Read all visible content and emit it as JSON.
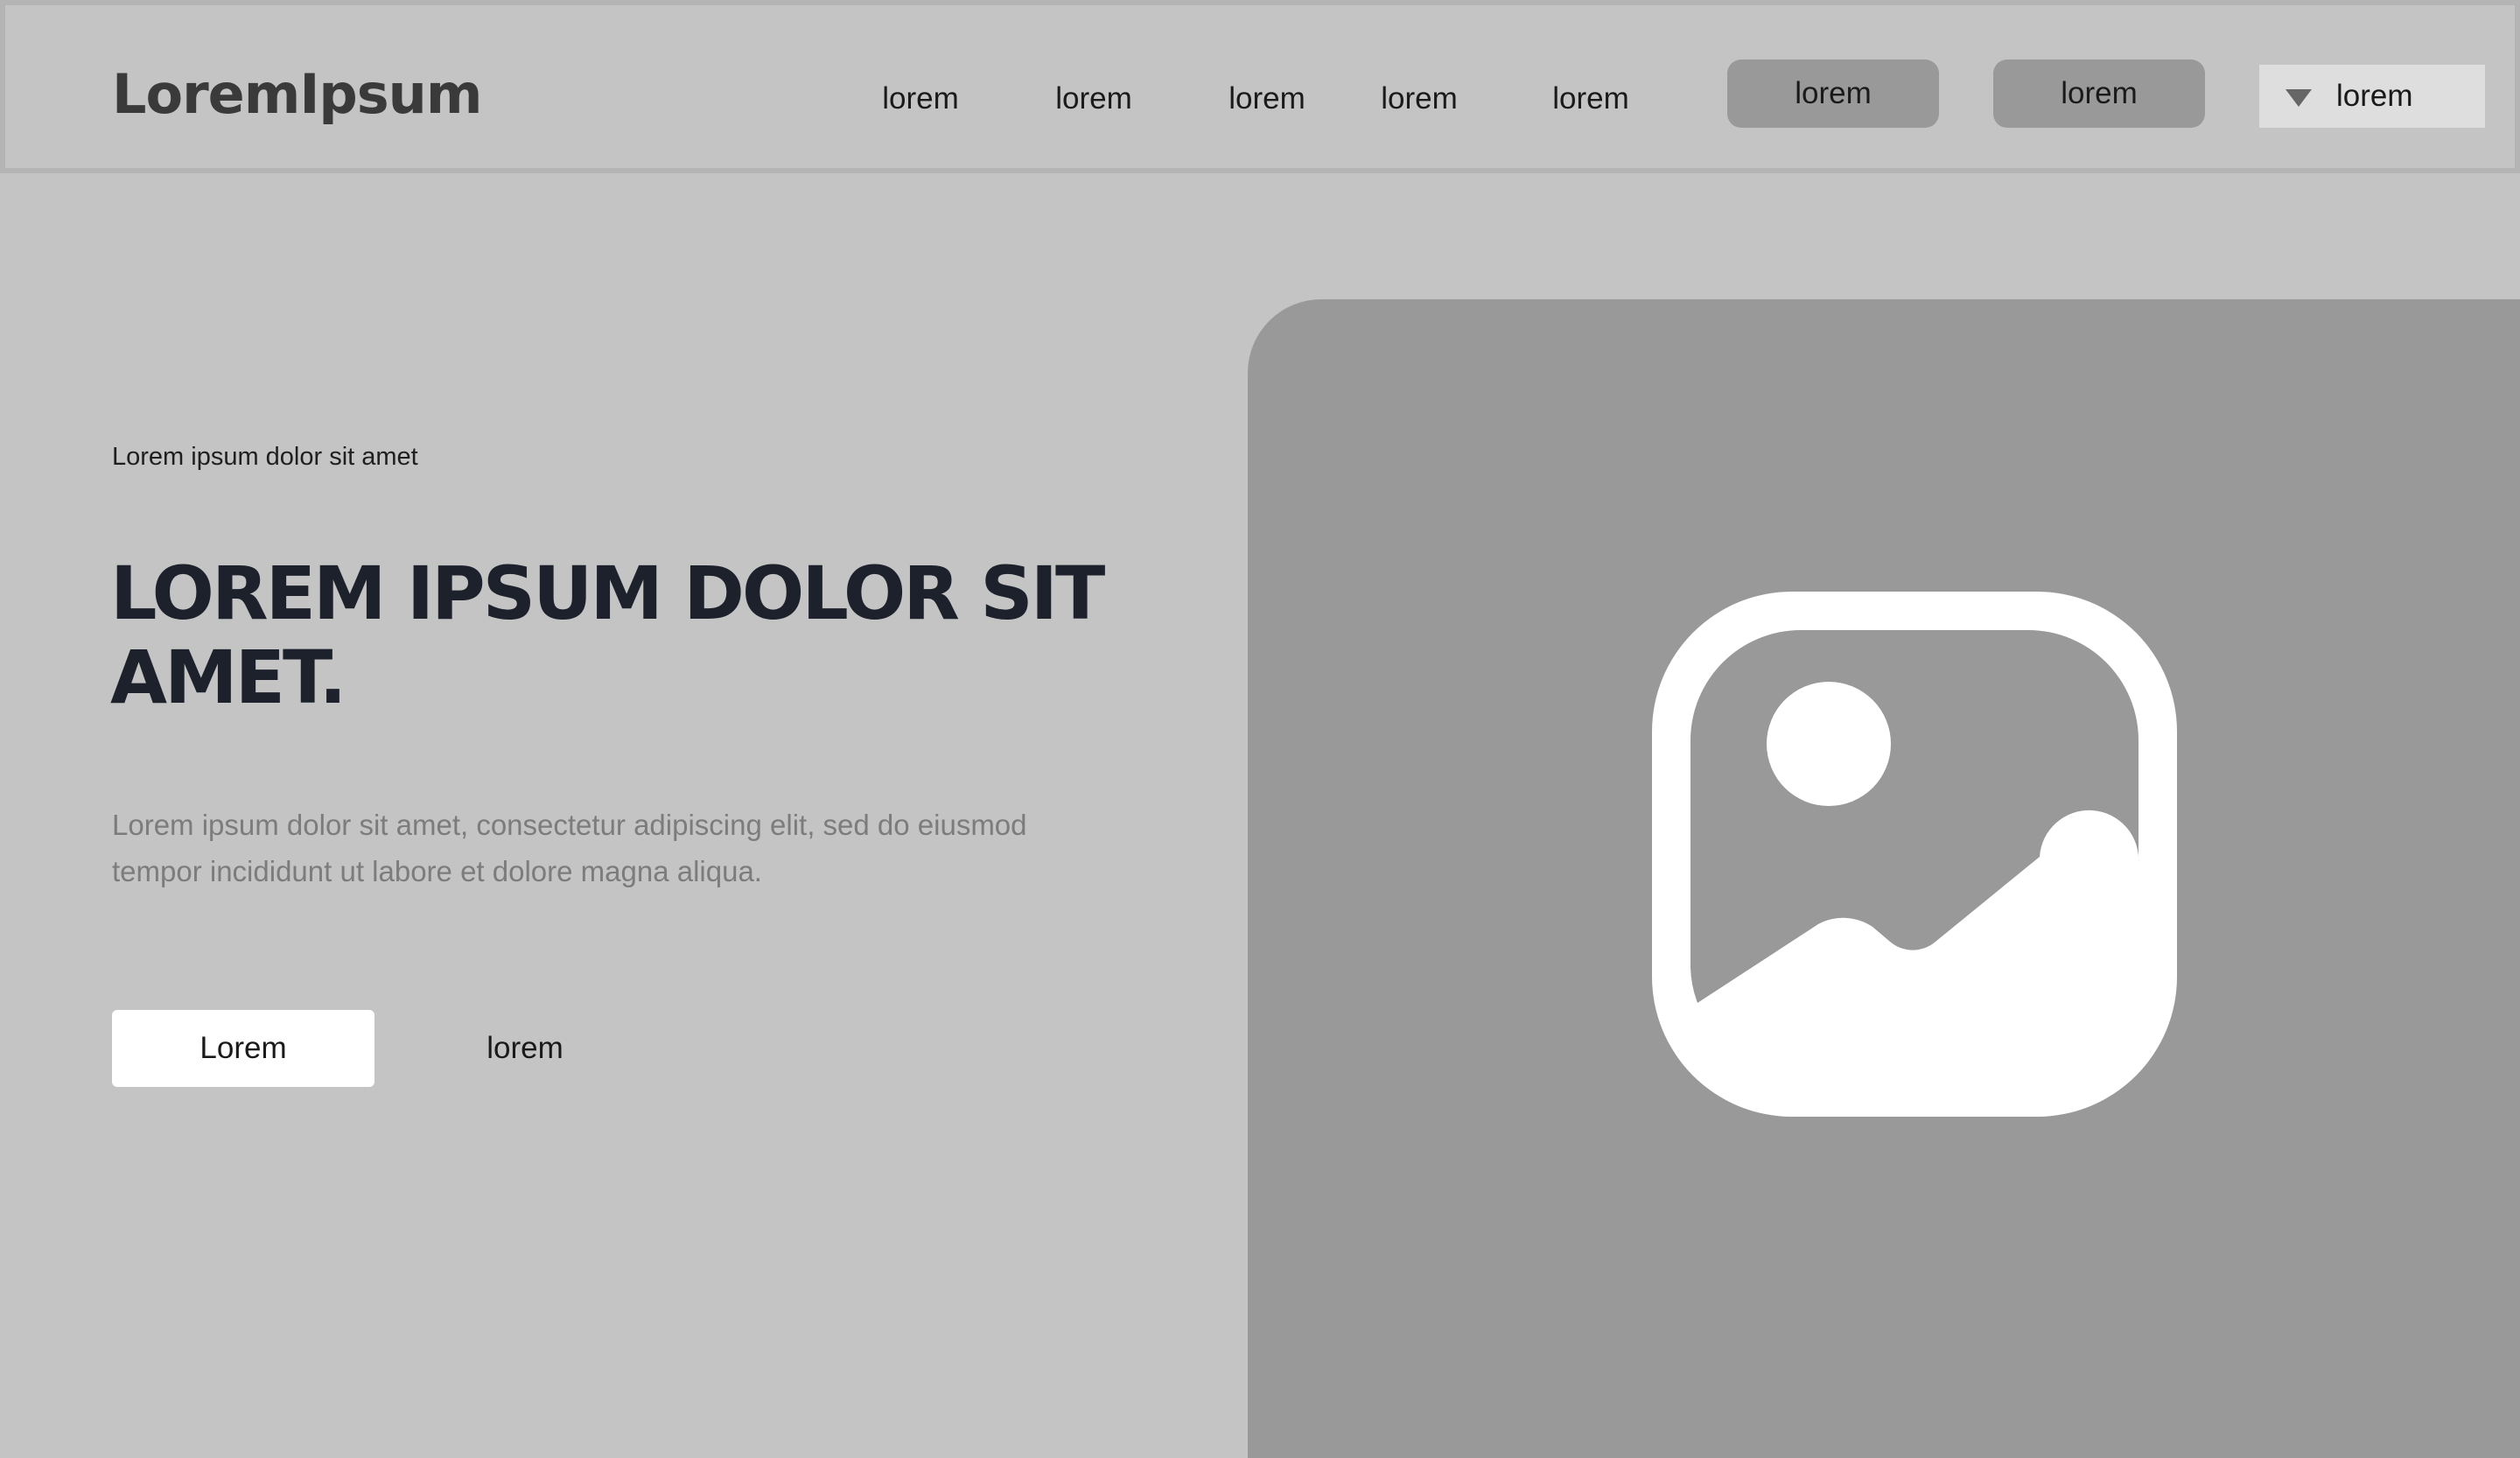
{
  "header": {
    "logo": "LoremIpsum",
    "nav_links": [
      "lorem",
      "lorem",
      "lorem",
      "lorem",
      "lorem"
    ],
    "nav_buttons": [
      "lorem",
      "lorem"
    ],
    "select": {
      "label": "lorem",
      "icon": "caret-down-icon"
    }
  },
  "hero": {
    "eyebrow": "Lorem ipsum dolor sit amet",
    "headline": "LOREM IPSUM DOLOR SIT AMET.",
    "body": "Lorem ipsum dolor sit amet, consectetur adipiscing elit, sed do eiusmod tempor incididunt ut labore et dolore magna aliqua.",
    "primary_button": "Lorem",
    "secondary_button": "lorem",
    "image_icon": "image-placeholder-icon"
  },
  "colors": {
    "page_background": "#c4c4c4",
    "image_panel": "#999999",
    "nav_button": "#999999",
    "select_background": "#dedede",
    "headline": "#1c212b",
    "body_text": "#7c7c7c"
  }
}
